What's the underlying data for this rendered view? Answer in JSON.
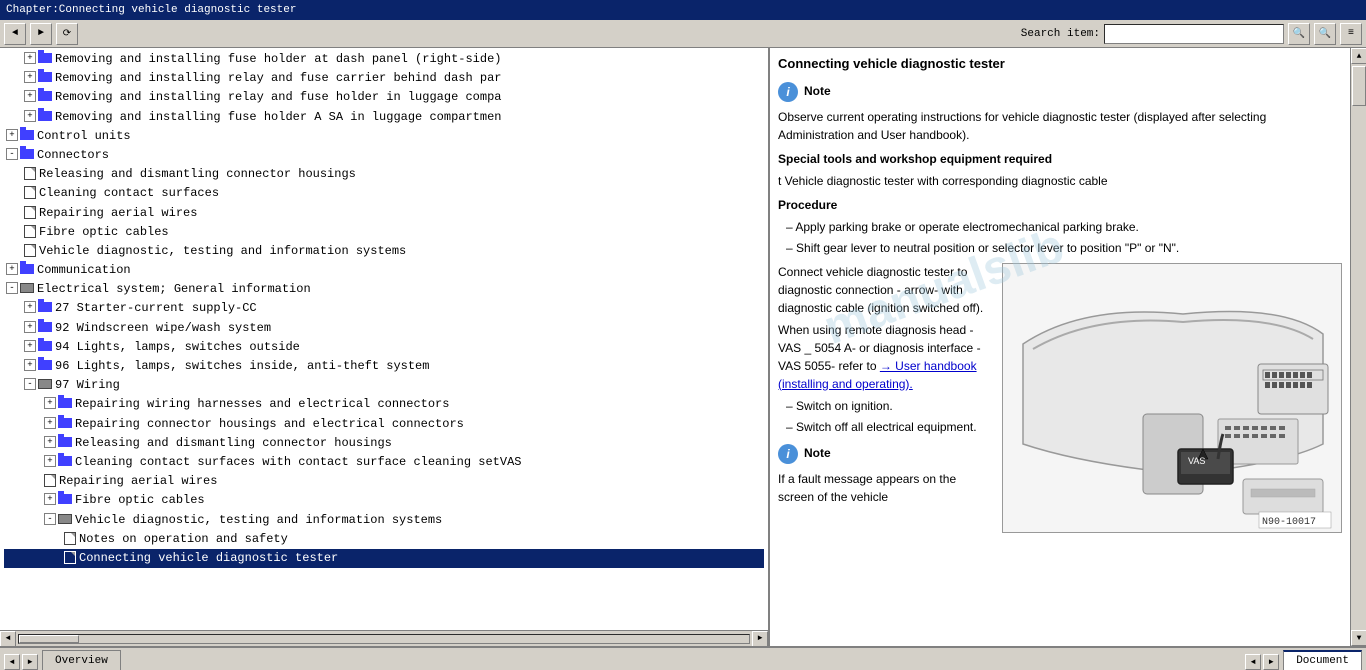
{
  "titleBar": {
    "text": "Chapter:Connecting vehicle diagnostic tester"
  },
  "toolbar": {
    "searchLabel": "Search item:",
    "searchPlaceholder": ""
  },
  "leftPanel": {
    "treeItems": [
      {
        "id": 1,
        "indent": 1,
        "type": "folder-doc",
        "expand": true,
        "text": "Removing and installing fuse holder at dash panel (right-side)"
      },
      {
        "id": 2,
        "indent": 1,
        "type": "folder-doc",
        "expand": true,
        "text": "Removing and installing relay and fuse carrier behind dash par"
      },
      {
        "id": 3,
        "indent": 1,
        "type": "folder-doc",
        "expand": true,
        "text": "Removing and installing relay and fuse holder in luggage compa"
      },
      {
        "id": 4,
        "indent": 1,
        "type": "folder-doc",
        "expand": true,
        "text": "Removing and installing fuse holder A SA in luggage compartmen"
      },
      {
        "id": 5,
        "indent": 0,
        "type": "folder",
        "expand": true,
        "text": "Control units"
      },
      {
        "id": 6,
        "indent": 0,
        "type": "folder",
        "expand": false,
        "text": "Connectors"
      },
      {
        "id": 7,
        "indent": 1,
        "type": "doc",
        "text": "Releasing and dismantling connector housings"
      },
      {
        "id": 8,
        "indent": 1,
        "type": "doc",
        "text": "Cleaning contact surfaces"
      },
      {
        "id": 9,
        "indent": 1,
        "type": "doc",
        "text": "Repairing aerial wires"
      },
      {
        "id": 10,
        "indent": 1,
        "type": "doc",
        "text": "Fibre optic cables"
      },
      {
        "id": 11,
        "indent": 1,
        "type": "doc",
        "text": "Vehicle diagnostic, testing and information systems"
      },
      {
        "id": 12,
        "indent": 0,
        "type": "folder",
        "expand": true,
        "text": "Communication"
      },
      {
        "id": 13,
        "indent": 0,
        "type": "doc",
        "text": "Electrical system; General information"
      },
      {
        "id": 14,
        "indent": 0,
        "type": "folder-open",
        "expand": false,
        "text": ""
      },
      {
        "id": 15,
        "indent": 1,
        "type": "folder",
        "expand": true,
        "text": "27 Starter-current supply-CC"
      },
      {
        "id": 16,
        "indent": 1,
        "type": "folder",
        "expand": true,
        "text": "92 Windscreen wipe/wash system"
      },
      {
        "id": 17,
        "indent": 1,
        "type": "folder",
        "expand": true,
        "text": "94 Lights, lamps, switches outside"
      },
      {
        "id": 18,
        "indent": 1,
        "type": "folder",
        "expand": true,
        "text": "96 Lights, lamps, switches inside, anti-theft system"
      },
      {
        "id": 19,
        "indent": 1,
        "type": "folder-open",
        "text": "97 Wiring"
      },
      {
        "id": 20,
        "indent": 2,
        "type": "folder",
        "expand": true,
        "text": "Repairing wiring harnesses and electrical connectors"
      },
      {
        "id": 21,
        "indent": 2,
        "type": "folder",
        "expand": true,
        "text": "Repairing connector housings and electrical connectors"
      },
      {
        "id": 22,
        "indent": 2,
        "type": "folder",
        "expand": true,
        "text": "Releasing and dismantling connector housings"
      },
      {
        "id": 23,
        "indent": 2,
        "type": "folder",
        "expand": true,
        "text": "Cleaning contact surfaces with contact surface cleaning setVAS"
      },
      {
        "id": 24,
        "indent": 2,
        "type": "doc",
        "text": "Repairing aerial wires"
      },
      {
        "id": 25,
        "indent": 2,
        "type": "folder",
        "expand": true,
        "text": "Fibre optic cables"
      },
      {
        "id": 26,
        "indent": 2,
        "type": "folder-open",
        "text": "Vehicle diagnostic, testing and information systems"
      },
      {
        "id": 27,
        "indent": 3,
        "type": "doc",
        "text": "Notes on operation and safety"
      },
      {
        "id": 28,
        "indent": 3,
        "type": "doc",
        "text": "Connecting vehicle diagnostic tester"
      }
    ]
  },
  "rightPanel": {
    "title": "Connecting vehicle diagnostic tester",
    "noteLabel": "Note",
    "noteText": "Observe current operating instructions for vehicle diagnostic tester (displayed after selecting Administration and User handbook).",
    "specialToolsLabel": "Special tools and workshop equipment required",
    "toolItem": "t  Vehicle diagnostic tester with corresponding diagnostic cable",
    "procedureLabel": "Procedure",
    "steps": [
      "Apply parking brake or operate electromechanical parking brake.",
      "Shift gear lever to neutral position or selector lever to position \"P\" or \"N\"."
    ],
    "connectText": "Connect vehicle diagnostic tester to diagnostic connection - arrow- with diagnostic cable (ignition switched off).",
    "remoteText": "When using remote diagnosis head -VAS _ 5054 A- or diagnosis interface -VAS 5055- refer to",
    "linkText": "→ User handbook (installing and operating).",
    "switchOnText": "– Switch on ignition.",
    "switchOffText": "– Switch off all electrical equipment.",
    "note2Label": "Note",
    "note2Text": "If a fault message appears on the screen of the vehicle",
    "imageLabel": "N90-10017",
    "arrowDiagnosticText": "arrow - With diagnostic"
  },
  "bottomTabs": {
    "leftTabs": [
      {
        "label": "Overview",
        "active": false
      }
    ],
    "rightTabs": [
      {
        "label": "Document",
        "active": true
      }
    ]
  },
  "icons": {
    "up": "▲",
    "down": "▼",
    "left": "◄",
    "right": "►",
    "minus": "-",
    "plus": "+"
  }
}
